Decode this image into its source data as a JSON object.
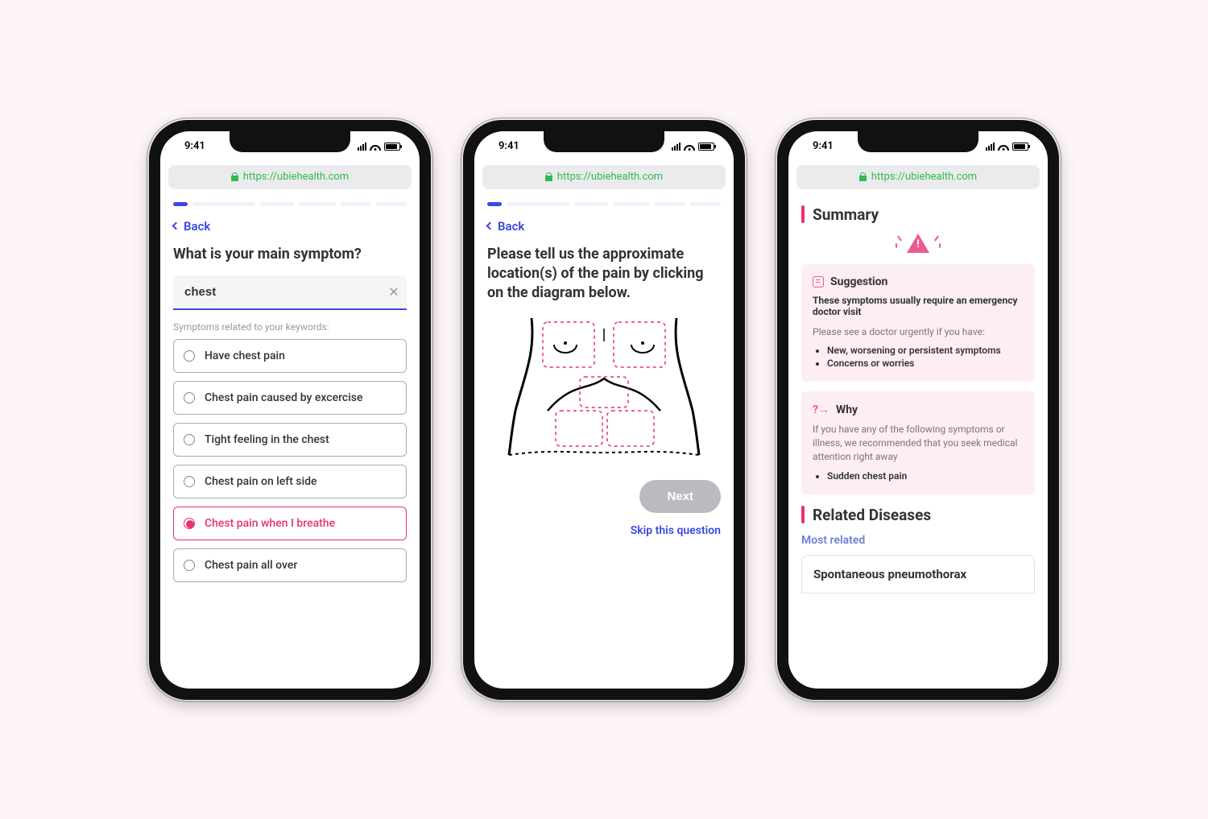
{
  "status": {
    "time": "9:41"
  },
  "urlbar": {
    "url": "https://ubiehealth.com"
  },
  "back": "Back",
  "screen1": {
    "question": "What is your main symptom?",
    "search_value": "chest",
    "hint": "Symptoms related to your keywords:",
    "options": [
      "Have chest pain",
      "Chest pain caused by excercise",
      "Tight feeling in the chest",
      "Chest pain on left side",
      "Chest pain when I breathe",
      "Chest pain all over"
    ],
    "selected_index": 4
  },
  "screen2": {
    "question": "Please tell us the approximate location(s) of the pain by clicking on the diagram below.",
    "next": "Next",
    "skip": "Skip this question"
  },
  "screen3": {
    "summary_title": "Summary",
    "suggestion": {
      "title": "Suggestion",
      "headline": "These symptoms usually require an emergency doctor visit",
      "lead": "Please see a doctor urgently if you have:",
      "bullets": [
        "New, worsening or persistent symptoms",
        "Concerns or worries"
      ]
    },
    "why": {
      "title": "Why",
      "lead": "If you have any of the following symptoms or illness, we recommended that you seek medical attention right away",
      "bullets": [
        "Sudden chest pain"
      ]
    },
    "related_title": "Related Diseases",
    "most_related": "Most related",
    "disease": "Spontaneous pneumothorax"
  }
}
